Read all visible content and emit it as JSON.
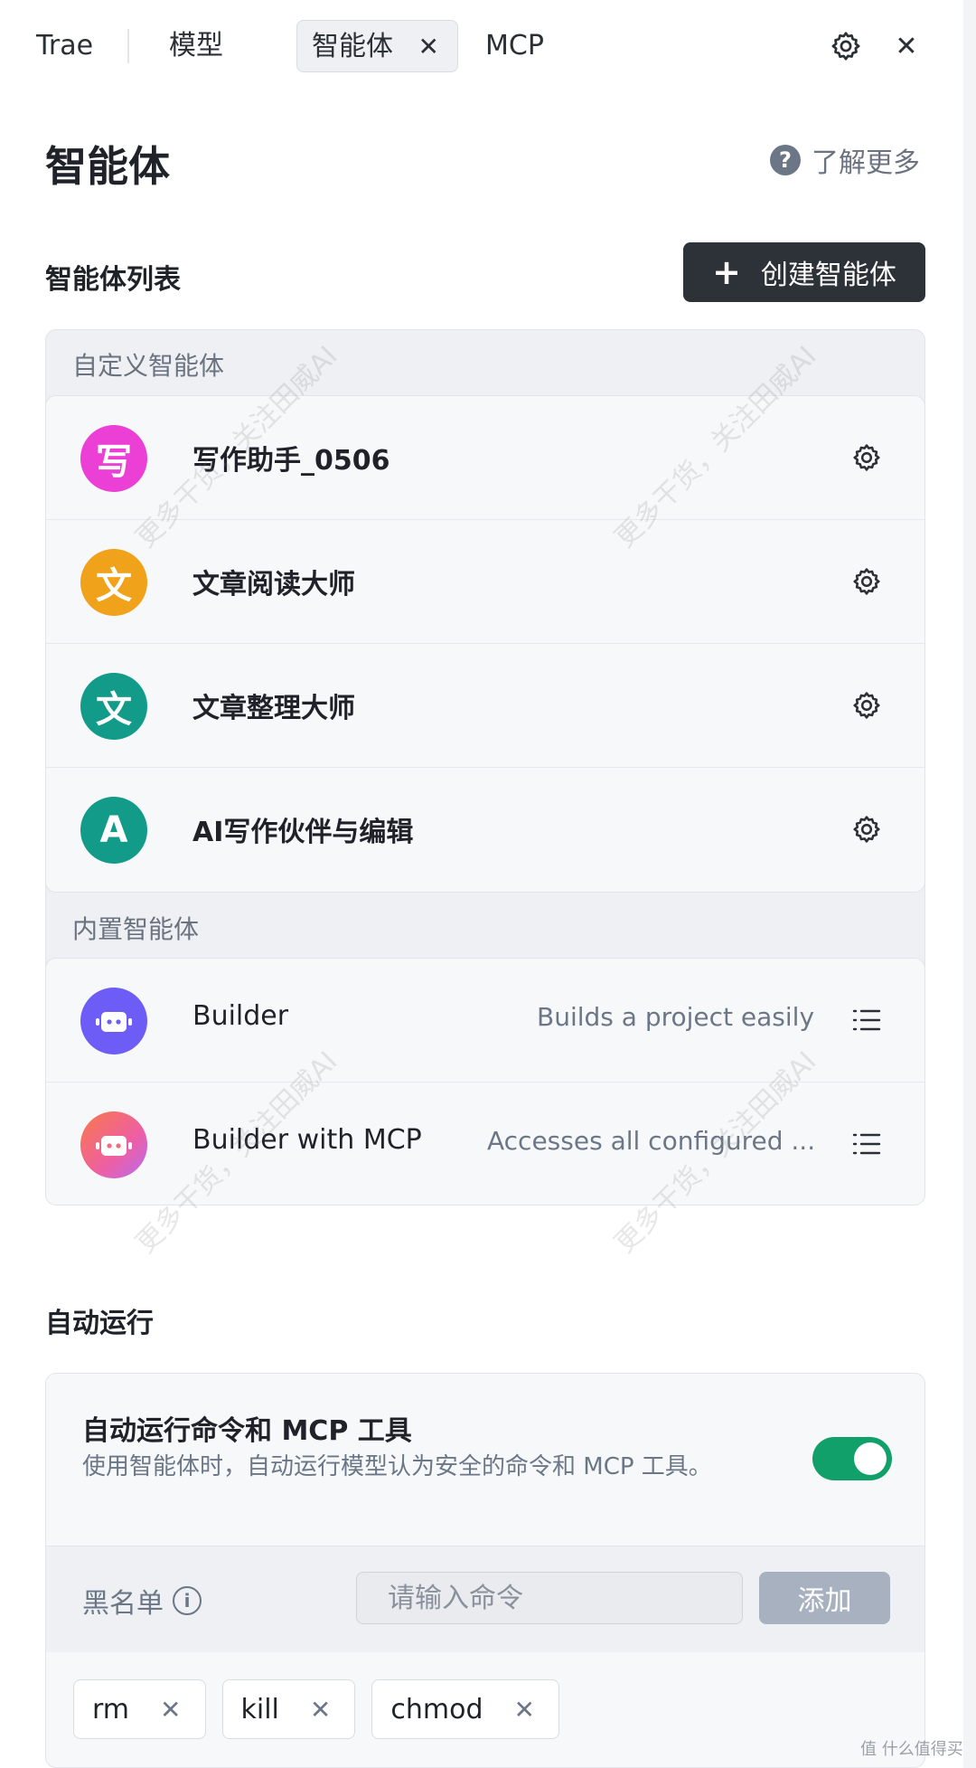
{
  "topbar": {
    "tabs": [
      {
        "label": "Trae"
      },
      {
        "label": "模型"
      },
      {
        "label": "智能体",
        "active": true
      },
      {
        "label": "MCP"
      }
    ],
    "active_close": "✕",
    "close": "✕"
  },
  "page": {
    "title": "智能体",
    "learn_more": "了解更多",
    "help_glyph": "?"
  },
  "agent_list": {
    "title": "智能体列表",
    "create_button": "创建智能体",
    "create_plus": "+",
    "custom_group": {
      "label": "自定义智能体",
      "items": [
        {
          "name": "写作助手_0506",
          "avatar": "写",
          "color": "#ec3fd6"
        },
        {
          "name": "文章阅读大师",
          "avatar": "文",
          "color": "#f0a21a"
        },
        {
          "name": "文章整理大师",
          "avatar": "文",
          "color": "#139b8a"
        },
        {
          "name": "AI写作伙伴与编辑",
          "avatar": "A",
          "color": "#139b8a"
        }
      ]
    },
    "builtin_group": {
      "label": "内置智能体",
      "items": [
        {
          "name": "Builder",
          "description": "Builds a project easily",
          "color": "#6d5cf5"
        },
        {
          "name": "Builder with MCP",
          "description": "Accesses all configured ...",
          "color": "#f36b7a"
        }
      ]
    }
  },
  "auto_run": {
    "section_title": "自动运行",
    "title": "自动运行命令和 MCP 工具",
    "description": "使用智能体时，自动运行模型认为安全的命令和 MCP 工具。",
    "toggle_on": true,
    "blacklist": {
      "label": "黑名单",
      "info_glyph": "i",
      "placeholder": "请输入命令",
      "add_button": "添加"
    },
    "chips": [
      "rm",
      "kill",
      "chmod"
    ],
    "chip_close": "✕"
  },
  "watermark": [
    "更多干货，关注田威AI",
    "更多干货，关注田威AI",
    "更多干货，关注田威AI",
    "更多干货，关注田威AI"
  ],
  "footer": "值 什么值得买"
}
